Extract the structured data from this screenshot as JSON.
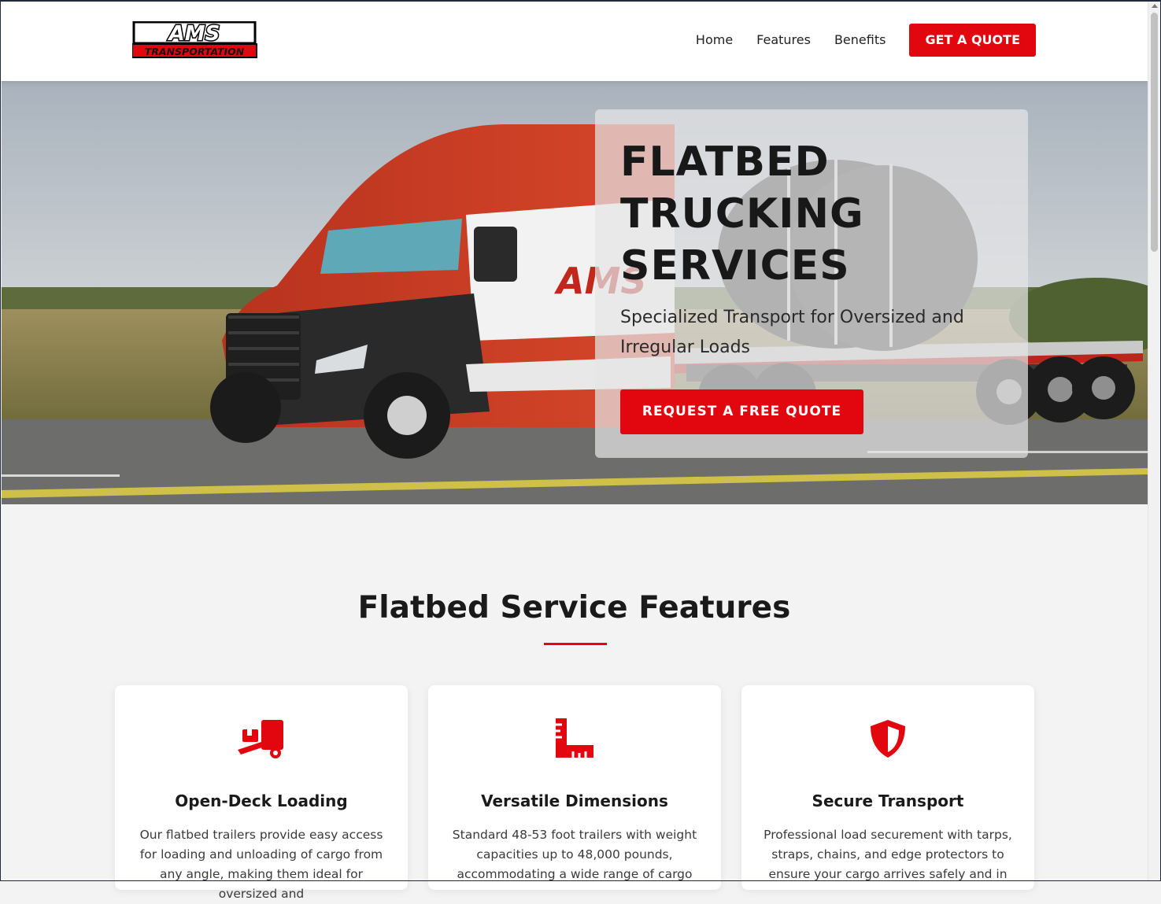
{
  "header": {
    "logo_text_top": "AMS",
    "logo_text_bottom": "TRANSPORTATION",
    "nav": [
      "Home",
      "Features",
      "Benefits"
    ],
    "cta_label": "GET A QUOTE"
  },
  "hero": {
    "title": "FLATBED TRUCKING SERVICES",
    "subtitle": "Specialized Transport for Oversized and Irregular Loads",
    "cta_label": "REQUEST A FREE QUOTE",
    "truck_logo_text": "AMS"
  },
  "features": {
    "title": "Flatbed Service Features",
    "cards": [
      {
        "icon": "dolly-loading-icon",
        "title": "Open-Deck Loading",
        "text": "Our flatbed trailers provide easy access for loading and unloading of cargo from any angle, making them ideal for oversized and"
      },
      {
        "icon": "ruler-combined-icon",
        "title": "Versatile Dimensions",
        "text": "Standard 48-53 foot trailers with weight capacities up to 48,000 pounds, accommodating a wide range of cargo"
      },
      {
        "icon": "shield-icon",
        "title": "Secure Transport",
        "text": "Professional load securement with tarps, straps, chains, and edge protectors to ensure your cargo arrives safely and in"
      }
    ]
  },
  "colors": {
    "accent": "#e2070f",
    "page_bg": "#f3f3f3",
    "text": "#1b1b1b"
  }
}
